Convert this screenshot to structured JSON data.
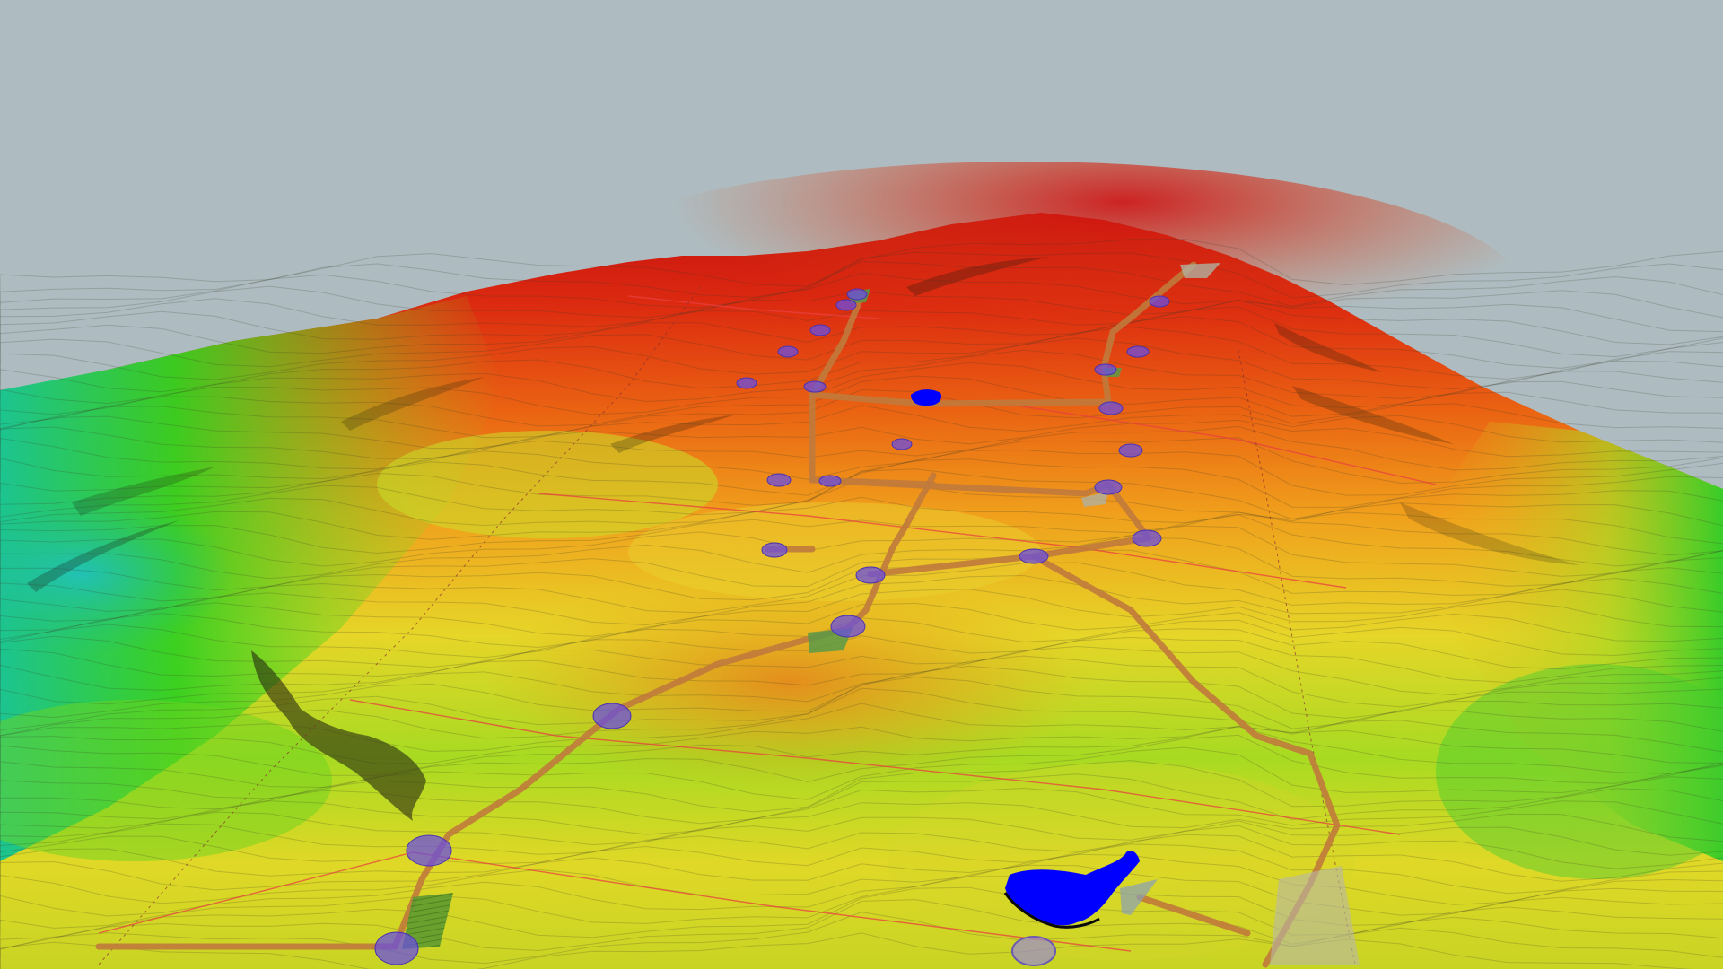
{
  "scene": {
    "sky_color": "#aebcc1",
    "elevation_ramp": [
      "#18b8b0",
      "#22c83a",
      "#7ed620",
      "#e8e020",
      "#f0a018",
      "#e86010",
      "#d82010"
    ],
    "road_color": "#c07a3c",
    "turbine_pad_color": "#6a4ee0",
    "water_color": "#0000ff",
    "boundary_line_color": "#e84040",
    "contour_color": "#3a3a2a"
  },
  "features": {
    "turbine_pads": [
      {
        "id": "T01"
      },
      {
        "id": "T02"
      },
      {
        "id": "T03"
      },
      {
        "id": "T04"
      },
      {
        "id": "T05"
      },
      {
        "id": "T06"
      },
      {
        "id": "T07"
      },
      {
        "id": "T08"
      },
      {
        "id": "T09"
      },
      {
        "id": "T10"
      },
      {
        "id": "T11"
      },
      {
        "id": "T12"
      },
      {
        "id": "T13"
      },
      {
        "id": "T14"
      },
      {
        "id": "T15"
      },
      {
        "id": "T16"
      },
      {
        "id": "T17"
      },
      {
        "id": "T18"
      },
      {
        "id": "T19"
      },
      {
        "id": "T20"
      },
      {
        "id": "T21"
      },
      {
        "id": "T22"
      },
      {
        "id": "T23"
      }
    ],
    "water_bodies": 2,
    "access_roads": 9,
    "compounds": 8
  }
}
